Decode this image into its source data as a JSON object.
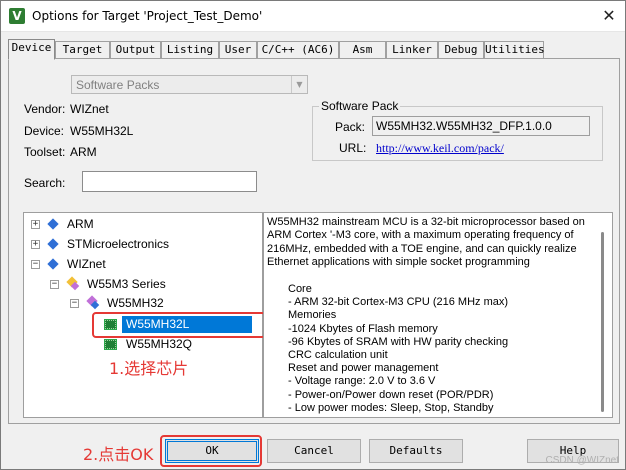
{
  "window": {
    "title": "Options for Target 'Project_Test_Demo'",
    "close_glyph": "✕",
    "app_icon_letter": "V"
  },
  "tabs": [
    {
      "label": "Device",
      "active": true
    },
    {
      "label": "Target"
    },
    {
      "label": "Output"
    },
    {
      "label": "Listing"
    },
    {
      "label": "User"
    },
    {
      "label": "C/C++ (AC6)"
    },
    {
      "label": "Asm"
    },
    {
      "label": "Linker"
    },
    {
      "label": "Debug"
    },
    {
      "label": "Utilities"
    }
  ],
  "device": {
    "pack_select": "Software Packs",
    "vendor_label": "Vendor:",
    "vendor": "WIZnet",
    "device_label": "Device:",
    "device": "W55MH32L",
    "toolset_label": "Toolset:",
    "toolset": "ARM",
    "search_label": "Search:",
    "search_value": ""
  },
  "software_pack": {
    "title": "Software Pack",
    "pack_label": "Pack:",
    "pack": "W55MH32.W55MH32_DFP.1.0.0",
    "url_label": "URL:",
    "url": "http://www.keil.com/pack/"
  },
  "tree": {
    "expand_plus": "+",
    "expand_minus": "−",
    "items": [
      {
        "label": "ARM"
      },
      {
        "label": "STMicroelectronics"
      },
      {
        "label": "WIZnet"
      },
      {
        "label": "W55M3 Series"
      },
      {
        "label": "W55MH32"
      },
      {
        "label": "W55MH32L",
        "selected": true
      },
      {
        "label": "W55MH32Q"
      }
    ]
  },
  "description": {
    "intro": "W55MH32 mainstream MCU is a 32-bit microprocessor based on ARM Cortex '-M3 core, with a maximum operating frequency of 216MHz, embedded with a TOE engine, and can quickly realize Ethernet applications with simple socket programming",
    "lines": [
      "Core",
      "- ARM 32-bit Cortex-M3 CPU (216 MHz max)",
      "Memories",
      "-1024 Kbytes of Flash memory",
      "-96 Kbytes of SRAM with HW parity checking",
      "CRC calculation unit",
      "Reset and power management",
      "- Voltage range: 2.0 V to 3.6 V",
      "- Power-on/Power down reset (POR/PDR)",
      "- Low power modes: Sleep, Stop, Standby"
    ]
  },
  "annotations": {
    "step1": "1.选择芯片",
    "step2": "2.点击OK"
  },
  "buttons": {
    "ok": "OK",
    "cancel": "Cancel",
    "defaults": "Defaults",
    "help": "Help"
  },
  "watermark": "CSDN @WIZnet",
  "colors": {
    "selection": "#0078d7",
    "annotation_red": "#e53935",
    "url_blue": "#0000cc"
  }
}
